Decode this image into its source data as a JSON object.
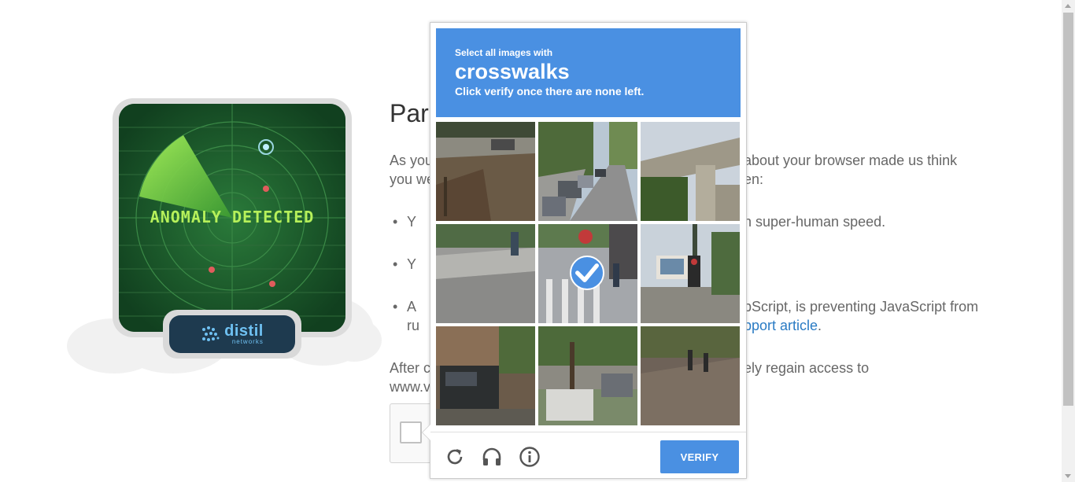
{
  "radar": {
    "display_text": "ANOMALY DETECTED",
    "brand_word": "distil",
    "brand_sub": "networks"
  },
  "content": {
    "title": "Parc",
    "p1_left": "As you",
    "p1_left2": "you we",
    "p1_right": "about your browser made us think",
    "p1_right2": "en:",
    "b1_left": "Y",
    "b1_right": "h super-human speed.",
    "b2_left": "Y",
    "b3_left": "A",
    "b3_left2": "ru",
    "b3_right": "pScript, is preventing JavaScript from",
    "b3_link": "pport article",
    "b3_end": ".",
    "p2_left": "After c",
    "p2_left2": "www.v",
    "p2_right": "ely regain access to"
  },
  "captcha": {
    "prompt_small": "Select all images with",
    "prompt_target": "crosswalks",
    "prompt_instruction": "Click verify once there are none left.",
    "tiles": [
      {
        "scene": "street-curb-dirt",
        "selected": false
      },
      {
        "scene": "street-cars-trees",
        "selected": false
      },
      {
        "scene": "overpass-tree",
        "selected": false
      },
      {
        "scene": "sidewalk-corner",
        "selected": false
      },
      {
        "scene": "crosswalk-stop-sign",
        "selected": true
      },
      {
        "scene": "traffic-light-billboard",
        "selected": false
      },
      {
        "scene": "suv-house",
        "selected": false
      },
      {
        "scene": "truck-trees",
        "selected": false
      },
      {
        "scene": "sidewalk-people",
        "selected": false
      }
    ],
    "footer": {
      "reload_icon": "reload-icon",
      "audio_icon": "headphones-icon",
      "info_icon": "info-icon",
      "verify_label": "VERIFY"
    },
    "accent": "#4a90e2"
  }
}
